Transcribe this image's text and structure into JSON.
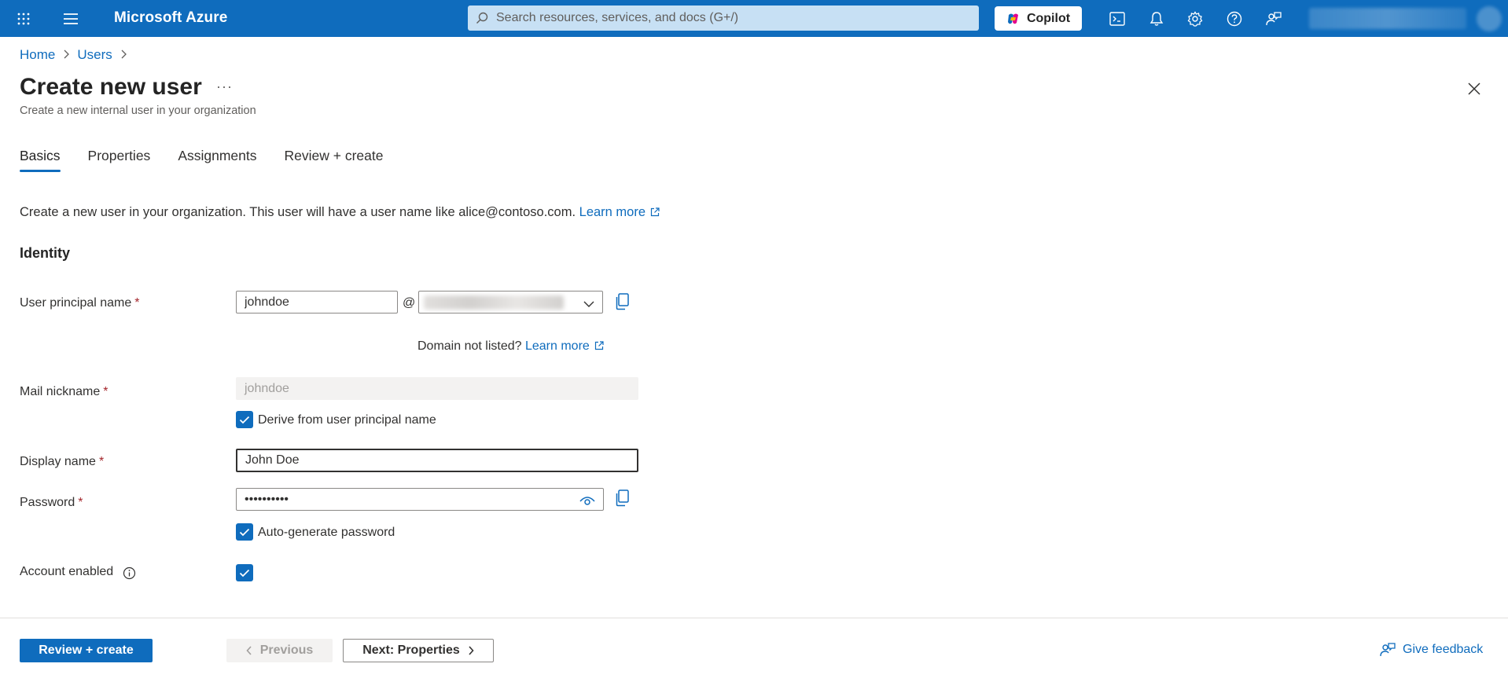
{
  "header": {
    "brand": "Microsoft Azure",
    "search_placeholder": "Search resources, services, and docs (G+/)",
    "copilot_label": "Copilot"
  },
  "breadcrumb": [
    "Home",
    "Users"
  ],
  "page": {
    "title": "Create new user",
    "subtitle": "Create a new internal user in your organization"
  },
  "tabs": [
    {
      "label": "Basics",
      "active": true
    },
    {
      "label": "Properties",
      "active": false
    },
    {
      "label": "Assignments",
      "active": false
    },
    {
      "label": "Review + create",
      "active": false
    }
  ],
  "intro": {
    "text": "Create a new user in your organization. This user will have a user name like alice@contoso.com.",
    "link": "Learn more"
  },
  "section_title": "Identity",
  "form": {
    "upn": {
      "label": "User principal name",
      "required_mark": "*",
      "value": "johndoe",
      "at": "@"
    },
    "domain_helper": {
      "text": "Domain not listed?",
      "link": "Learn more"
    },
    "mail_nickname": {
      "label": "Mail nickname",
      "required_mark": "*",
      "value": "johndoe"
    },
    "derive_checkbox": {
      "label": "Derive from user principal name",
      "checked": true
    },
    "display_name": {
      "label": "Display name",
      "required_mark": "*",
      "value": "John Doe"
    },
    "password": {
      "label": "Password",
      "required_mark": "*",
      "value": "••••••••••"
    },
    "autogen_checkbox": {
      "label": "Auto-generate password",
      "checked": true
    },
    "account_enabled": {
      "label": "Account enabled",
      "checked": true
    }
  },
  "footer": {
    "review_create": "Review + create",
    "previous": "Previous",
    "next": "Next: Properties",
    "feedback": "Give feedback"
  },
  "colors": {
    "accent": "#0f6cbd",
    "search_bg": "#c7e0f4",
    "required": "#a4262c"
  }
}
